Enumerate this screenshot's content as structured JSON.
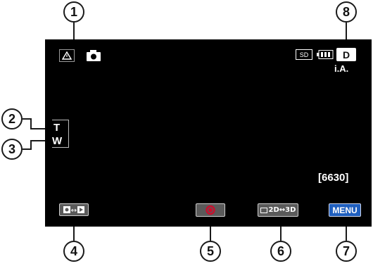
{
  "callouts": [
    "1",
    "2",
    "3",
    "4",
    "5",
    "6",
    "7",
    "8"
  ],
  "screen": {
    "left_icons": {
      "shake_warning": "triangle-icon",
      "still_mode": "camera-icon"
    },
    "zoom": {
      "tele": "T",
      "wide": "W"
    },
    "status": {
      "media": "SD",
      "battery": "battery-icon",
      "display_mode": "D",
      "scene_mode": "i.A."
    },
    "remaining_shots": "[6630]",
    "buttons": {
      "mode_switch": "record-play-switch-icon",
      "record": "record-icon",
      "dimension": "2D↔3D",
      "menu": "MENU"
    }
  },
  "colors": {
    "screen_bg": "#000000",
    "record_button": "#c8102e",
    "menu_button": "#1f5fbf",
    "callout_border": "#1a1a1a"
  }
}
